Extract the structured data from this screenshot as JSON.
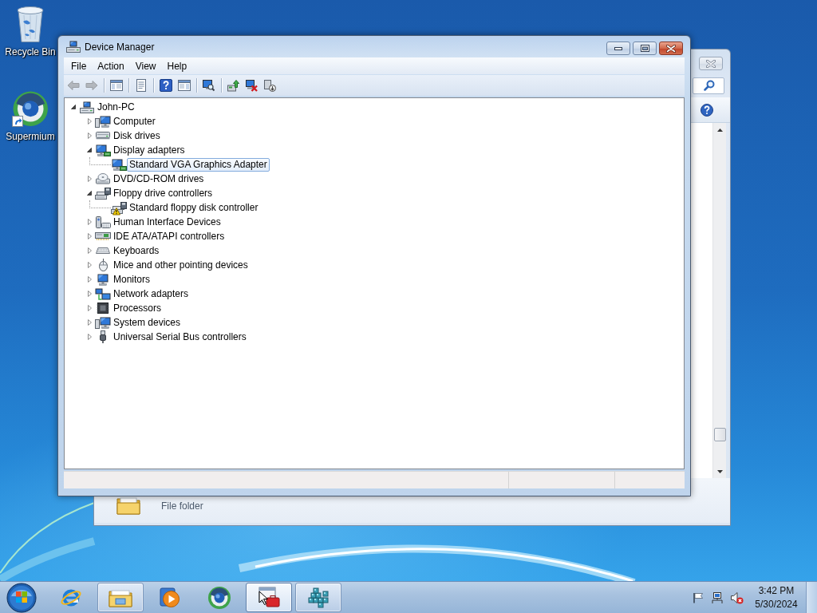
{
  "desktop": {
    "icons": [
      {
        "label": "Recycle Bin",
        "kind": "bin",
        "shortcut": false
      },
      {
        "label": "Supermium",
        "kind": "sphere",
        "shortcut": true
      }
    ]
  },
  "background_window": {
    "details": {
      "type": "File folder"
    }
  },
  "window": {
    "title": "Device Manager"
  },
  "menu": [
    {
      "label": "File"
    },
    {
      "label": "Action"
    },
    {
      "label": "View"
    },
    {
      "label": "Help"
    }
  ],
  "toolbar": [
    [
      {
        "kind": "back",
        "disabled": true
      },
      {
        "kind": "forward",
        "disabled": true
      }
    ],
    [
      {
        "kind": "tree",
        "disabled": false
      }
    ],
    [
      {
        "kind": "properties",
        "disabled": false
      }
    ],
    [
      {
        "kind": "help",
        "disabled": false
      },
      {
        "kind": "pane",
        "disabled": false
      }
    ],
    [
      {
        "kind": "scan",
        "disabled": false
      }
    ],
    [
      {
        "kind": "update",
        "disabled": false
      },
      {
        "kind": "uninstall",
        "disabled": false
      },
      {
        "kind": "disable",
        "disabled": false
      }
    ]
  ],
  "tree": {
    "label": "John-PC",
    "kind": "pc",
    "expanded": true,
    "selected": false,
    "children": [
      {
        "label": "Computer",
        "kind": "computer",
        "expanded": false,
        "selected": false
      },
      {
        "label": "Disk drives",
        "kind": "disk",
        "expanded": false,
        "selected": false
      },
      {
        "label": "Display adapters",
        "kind": "display",
        "expanded": true,
        "selected": false,
        "children": [
          {
            "label": "Standard VGA Graphics Adapter",
            "kind": "display",
            "selected": true,
            "warning": false
          }
        ]
      },
      {
        "label": "DVD/CD-ROM drives",
        "kind": "dvd",
        "expanded": false,
        "selected": false
      },
      {
        "label": "Floppy drive controllers",
        "kind": "floppy",
        "expanded": true,
        "selected": false,
        "children": [
          {
            "label": "Standard floppy disk controller",
            "kind": "floppy",
            "selected": false,
            "warning": true
          }
        ]
      },
      {
        "label": "Human Interface Devices",
        "kind": "hid",
        "expanded": false,
        "selected": false
      },
      {
        "label": "IDE ATA/ATAPI controllers",
        "kind": "ide",
        "expanded": false,
        "selected": false
      },
      {
        "label": "Keyboards",
        "kind": "keyboard",
        "expanded": false,
        "selected": false
      },
      {
        "label": "Mice and other pointing devices",
        "kind": "mouse",
        "expanded": false,
        "selected": false
      },
      {
        "label": "Monitors",
        "kind": "monitor",
        "expanded": false,
        "selected": false
      },
      {
        "label": "Network adapters",
        "kind": "network",
        "expanded": false,
        "selected": false
      },
      {
        "label": "Processors",
        "kind": "processor",
        "expanded": false,
        "selected": false
      },
      {
        "label": "System devices",
        "kind": "computer",
        "expanded": false,
        "selected": false
      },
      {
        "label": "Universal Serial Bus controllers",
        "kind": "usb",
        "expanded": false,
        "selected": false
      }
    ]
  },
  "taskbar": {
    "items": [
      {
        "kind": "browser",
        "running": false,
        "active": false
      },
      {
        "kind": "folder",
        "running": true,
        "active": false
      },
      {
        "kind": "media",
        "running": false,
        "active": false
      },
      {
        "kind": "sphere",
        "running": false,
        "active": false
      },
      {
        "kind": "devices",
        "running": true,
        "active": true
      },
      {
        "kind": "registry",
        "running": true,
        "active": false
      }
    ],
    "tray": {
      "volume_muted": true
    },
    "clock": {
      "time": "3:42 PM",
      "date": "5/30/2024"
    }
  }
}
